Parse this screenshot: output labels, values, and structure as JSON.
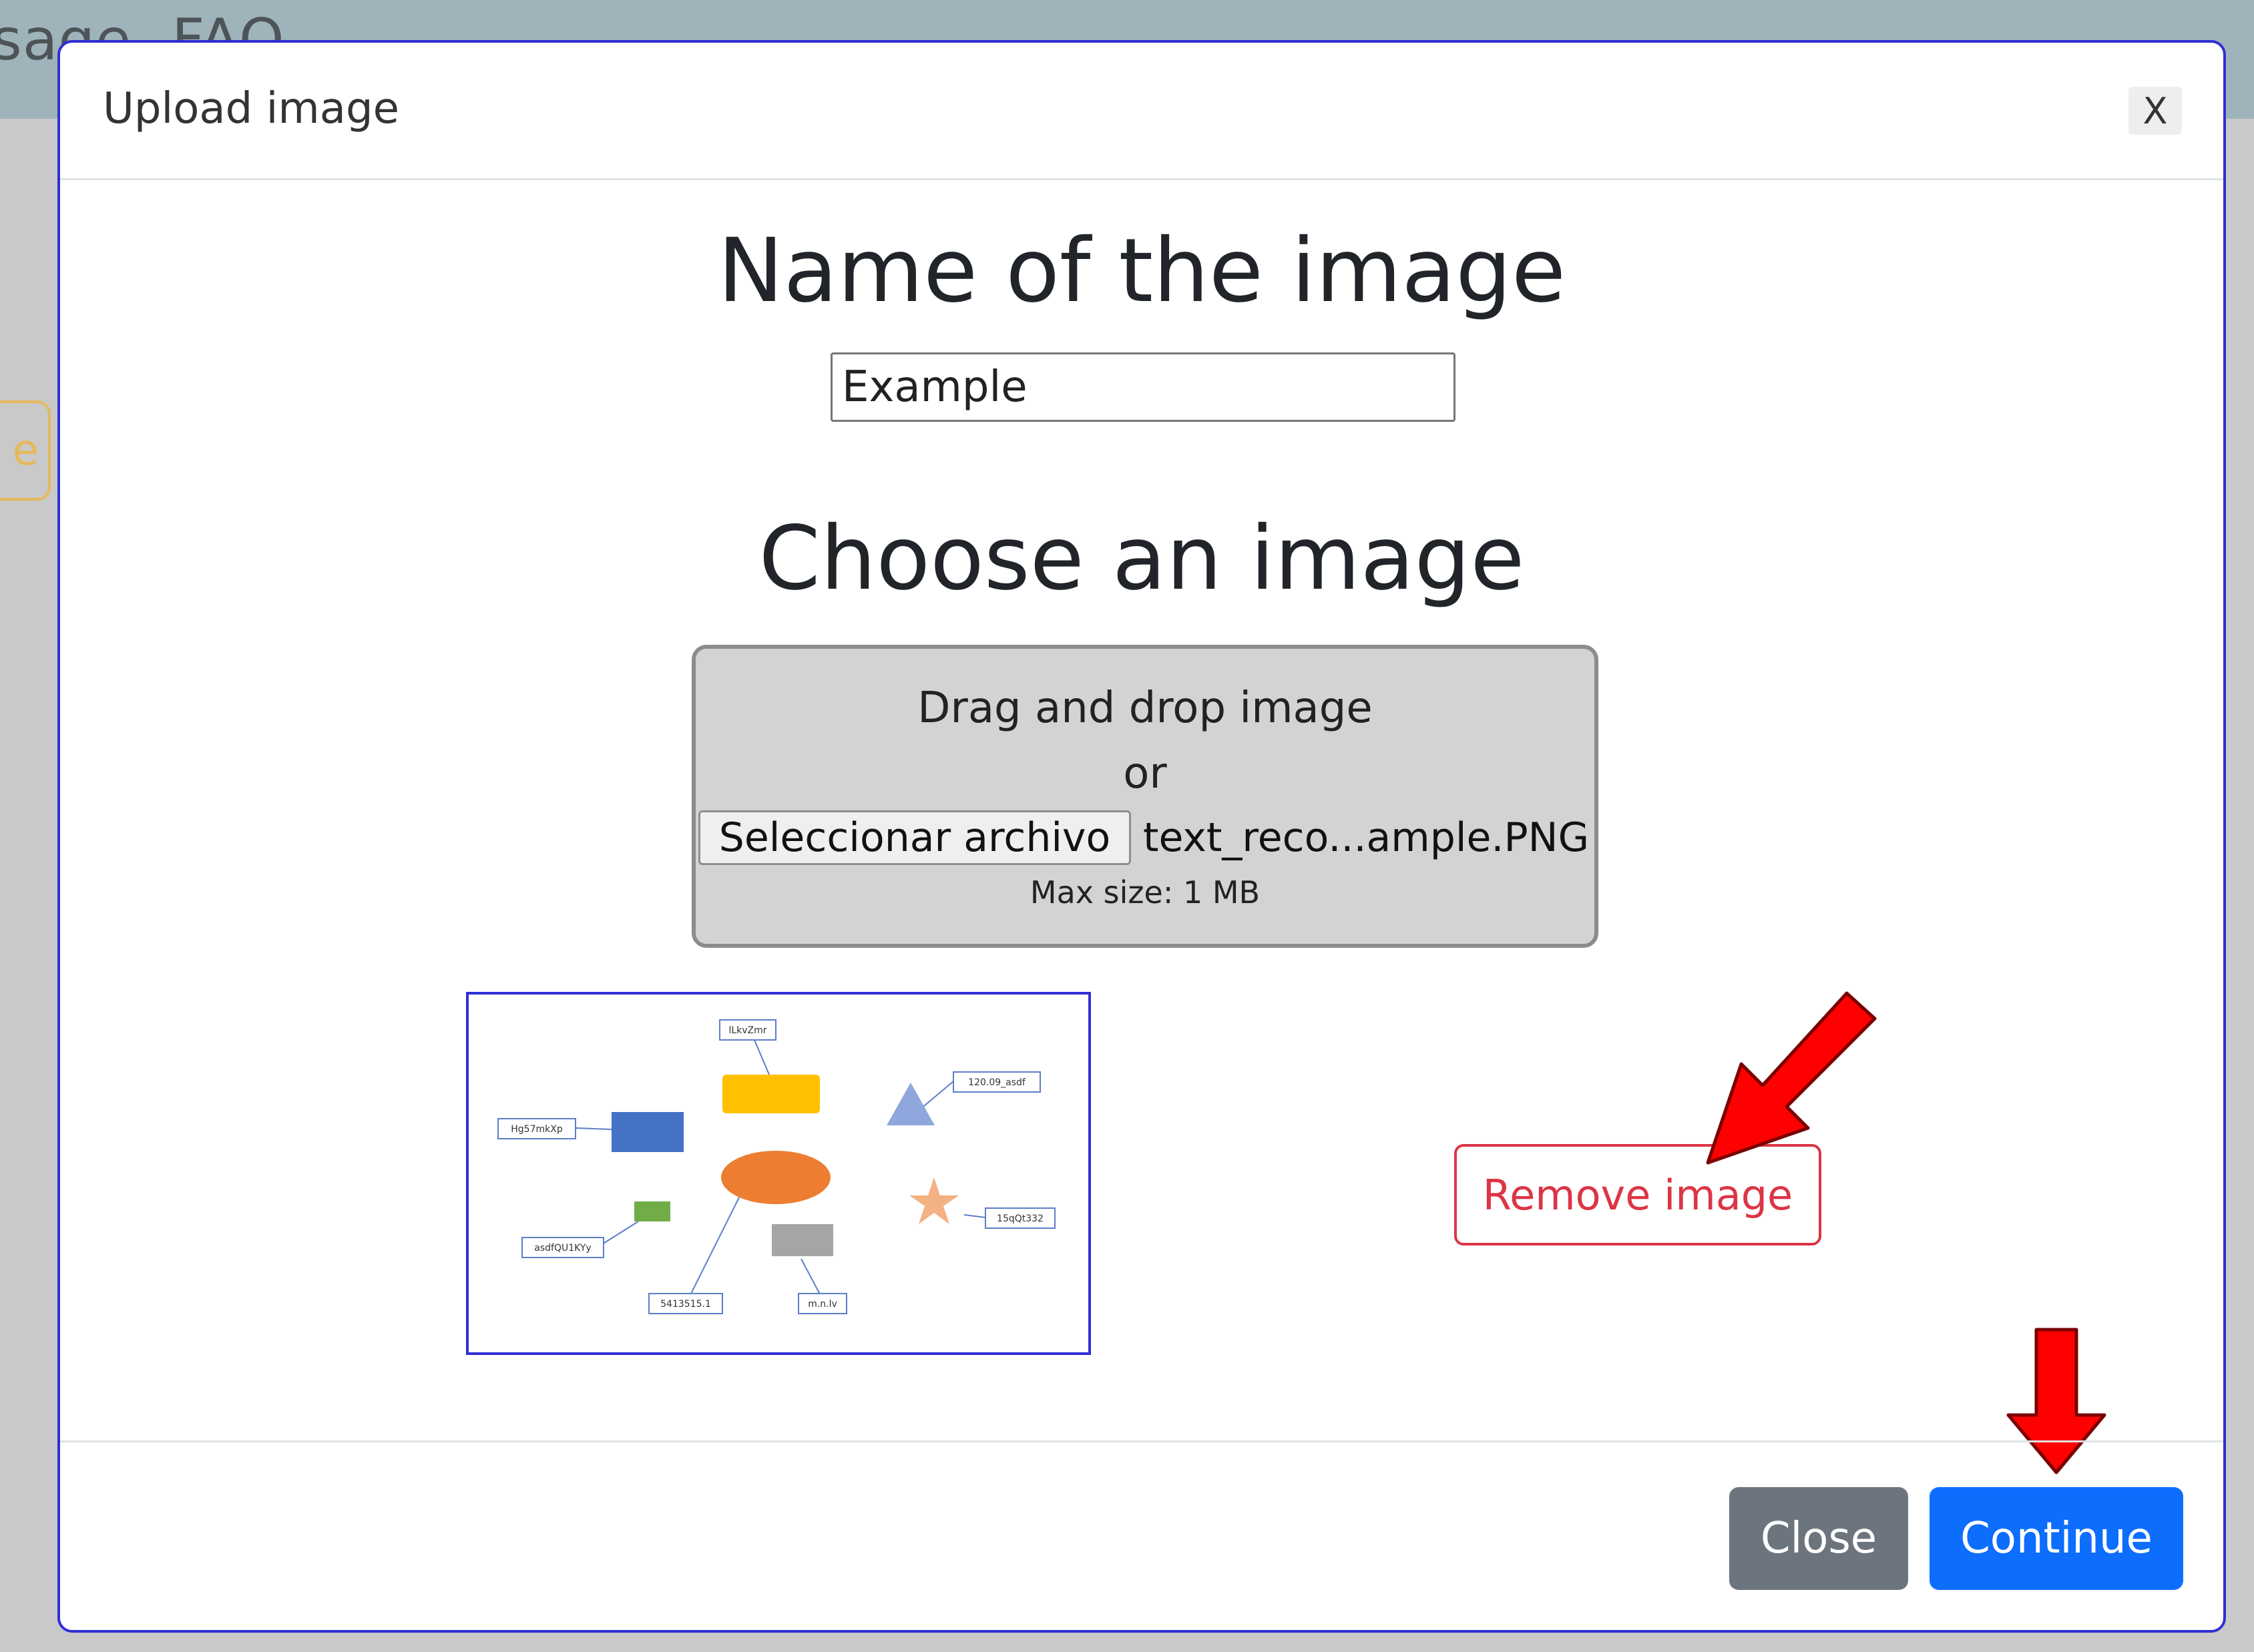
{
  "background": {
    "nav_items": [
      "sage",
      "FAQ"
    ],
    "peek_button_label": "e"
  },
  "modal": {
    "title": "Upload image",
    "header_close_label": "X",
    "name_heading": "Name of the image",
    "name_input_value": "Example",
    "choose_heading": "Choose an image",
    "dropzone": {
      "line1": "Drag and drop image",
      "line2": "or",
      "file_button_label": "Seleccionar archivo",
      "file_name": "text_reco...ample.PNG",
      "max_size": "Max size: 1 MB"
    },
    "preview": {
      "labels": [
        "lLkvZmr",
        "120.09_asdf",
        "Hg57mkXp",
        "15qQt332",
        "asdfQU1KYy",
        "5413515.1",
        "m.n.lv"
      ]
    },
    "remove_label": "Remove image",
    "footer": {
      "close_label": "Close",
      "continue_label": "Continue"
    }
  },
  "colors": {
    "primary": "#0d6efd",
    "secondary": "#6c757d",
    "danger": "#dc3545",
    "annotation_arrow": "#ff0000"
  }
}
